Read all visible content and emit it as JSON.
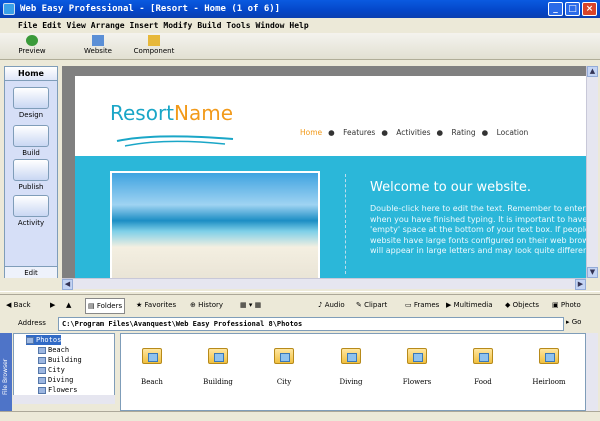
{
  "window": {
    "title": "Web Easy Professional - [Resort - Home (1 of 6)]"
  },
  "menu": [
    "File",
    "Edit",
    "View",
    "Arrange",
    "Insert",
    "Modify",
    "Build",
    "Tools",
    "Window",
    "Help"
  ],
  "toolbar": {
    "preview": "Preview",
    "website": "Website",
    "component": "Component"
  },
  "sidebar": {
    "header": "Home",
    "items": [
      "Design",
      "Build",
      "Publish",
      "Activity"
    ],
    "footer": "Edit"
  },
  "site": {
    "logo_a": "Resort",
    "logo_b": "Name",
    "nav": [
      "Home",
      "Features",
      "Activities",
      "Rating",
      "Location"
    ],
    "welcome": "Welcome to our website.",
    "body": [
      "Double-click here to edit the text. Remember to enter",
      "when you have finished typing. It is important to have",
      "'empty' space at the bottom of your text box. If people",
      "website have large fonts configured on their web browser",
      "will appear in large letters and may look quite different"
    ]
  },
  "browser": {
    "back": "Back",
    "folders": "Folders",
    "favorites": "Favorites",
    "history": "History",
    "tabs": [
      "Audio",
      "Clipart",
      "Frames",
      "Multimedia",
      "Objects",
      "Photo"
    ],
    "address_label": "Address",
    "address": "C:\\Program Files\\Avanquest\\Web Easy Professional 8\\Photos",
    "go": "Go",
    "side_label": "File Browser",
    "tree_root": "Photos",
    "tree": [
      "Beach",
      "Building",
      "City",
      "Diving",
      "Flowers"
    ],
    "files": [
      "Beach",
      "Building",
      "City",
      "Diving",
      "Flowers",
      "Food",
      "Heirloom"
    ]
  },
  "colors": {
    "accent": "#2bb7d9",
    "logo_orange": "#f29a1a",
    "titlebar": "#0a5ae0"
  }
}
